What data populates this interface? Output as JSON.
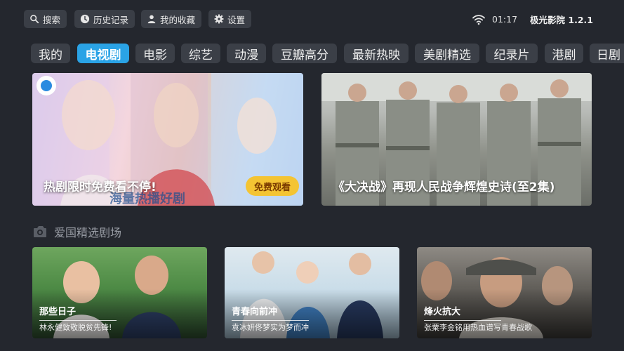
{
  "toolbar": {
    "search_label": "搜索",
    "history_label": "历史记录",
    "favorites_label": "我的收藏",
    "settings_label": "设置"
  },
  "status": {
    "time": "01:17",
    "app_name": "极光影院 1.2.1"
  },
  "tabs": [
    {
      "label": "我的",
      "active": false
    },
    {
      "label": "电视剧",
      "active": true
    },
    {
      "label": "电影",
      "active": false
    },
    {
      "label": "综艺",
      "active": false
    },
    {
      "label": "动漫",
      "active": false
    },
    {
      "label": "豆瓣高分",
      "active": false
    },
    {
      "label": "最新热映",
      "active": false
    },
    {
      "label": "美剧精选",
      "active": false
    },
    {
      "label": "纪录片",
      "active": false
    },
    {
      "label": "港剧",
      "active": false
    },
    {
      "label": "日剧",
      "active": false
    }
  ],
  "banners": [
    {
      "caption": "热剧限时免费看不停!",
      "badge": "免费观看",
      "art_text": "海量热播好剧"
    },
    {
      "caption": "《大决战》再现人民战争辉煌史诗(至2集)"
    }
  ],
  "section": {
    "title": "爱国精选剧场"
  },
  "cards": [
    {
      "title": "那些日子",
      "subtitle": "林永健致敬脱贫先锋!"
    },
    {
      "title": "青春向前冲",
      "subtitle": "袁冰妍佟梦实为梦而冲"
    },
    {
      "title": "烽火抗大",
      "subtitle": "张粟李金铭用热血谱写青春战歌"
    }
  ],
  "colors": {
    "background": "#24272e",
    "accent": "#2aa3e6",
    "pill": "#3a3e46"
  }
}
